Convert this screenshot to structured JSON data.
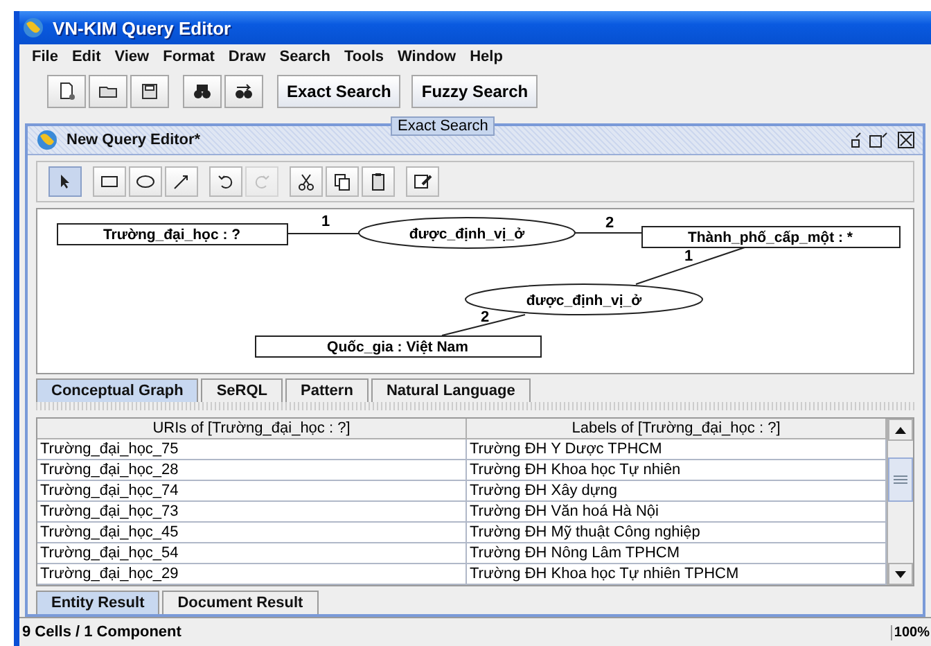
{
  "window": {
    "title": "VN-KIM Query Editor"
  },
  "menu": [
    {
      "label": "File"
    },
    {
      "label": "Edit"
    },
    {
      "label": "View"
    },
    {
      "label": "Format"
    },
    {
      "label": "Draw"
    },
    {
      "label": "Search"
    },
    {
      "label": "Tools"
    },
    {
      "label": "Window"
    },
    {
      "label": "Help"
    }
  ],
  "toolbar": {
    "icon_buttons": [
      {
        "kind": "new"
      },
      {
        "kind": "open"
      },
      {
        "kind": "save"
      },
      {
        "kind": "find"
      },
      {
        "kind": "replace"
      }
    ],
    "buttons": [
      "Exact Search",
      "Fuzzy Search"
    ]
  },
  "tooltip": "Exact Search",
  "internal_frame": {
    "title": "New Query Editor*"
  },
  "draw_tools": [
    {
      "kind": "pointer",
      "selected": true,
      "disabled": false
    },
    {
      "kind": "rect",
      "selected": false,
      "disabled": false
    },
    {
      "kind": "ellipse",
      "selected": false,
      "disabled": false
    },
    {
      "kind": "connector",
      "selected": false,
      "disabled": false
    },
    {
      "kind": "undo",
      "selected": false,
      "disabled": false
    },
    {
      "kind": "redo",
      "selected": false,
      "disabled": true
    },
    {
      "kind": "cut",
      "selected": false,
      "disabled": false
    },
    {
      "kind": "copy",
      "selected": false,
      "disabled": false
    },
    {
      "kind": "paste",
      "selected": false,
      "disabled": false
    },
    {
      "kind": "edit",
      "selected": false,
      "disabled": false
    }
  ],
  "graph": {
    "nodes": [
      {
        "kind": "concept",
        "label": "Trường_đại_học : ?"
      },
      {
        "kind": "relation",
        "label": "được_định_vị_ở"
      },
      {
        "kind": "concept",
        "label": "Thành_phố_cấp_một : *"
      },
      {
        "kind": "relation",
        "label": "được_định_vị_ở"
      },
      {
        "kind": "concept",
        "label": "Quốc_gia : Việt Nam"
      }
    ],
    "edges": [
      {
        "label": "1"
      },
      {
        "label": "2"
      },
      {
        "label": "1"
      },
      {
        "label": "2"
      }
    ]
  },
  "query_tabs": [
    {
      "label": "Conceptual Graph",
      "selected": true
    },
    {
      "label": "SeRQL",
      "selected": false
    },
    {
      "label": "Pattern",
      "selected": false
    },
    {
      "label": "Natural Language",
      "selected": false
    }
  ],
  "table": {
    "columns": [
      "URIs of [Trường_đại_học : ?]",
      "Labels of [Trường_đại_học : ?]"
    ],
    "rows": [
      [
        "Trường_đại_học_75",
        "Trường ĐH Y Dược TPHCM"
      ],
      [
        "Trường_đại_học_28",
        "Trường ĐH Khoa học Tự nhiên"
      ],
      [
        "Trường_đại_học_74",
        "Trường ĐH Xây dựng"
      ],
      [
        "Trường_đại_học_73",
        "Trường ĐH Văn hoá Hà Nội"
      ],
      [
        "Trường_đại_học_45",
        "Trường ĐH Mỹ thuật Công nghiệp"
      ],
      [
        "Trường_đại_học_54",
        "Trường ĐH Nông Lâm TPHCM"
      ],
      [
        "Trường_đại_học_29",
        "Trường ĐH Khoa học Tự nhiên TPHCM"
      ]
    ]
  },
  "result_tabs": [
    {
      "label": "Entity Result",
      "selected": true
    },
    {
      "label": "Document Result",
      "selected": false
    }
  ],
  "status_bar": {
    "text": "9 Cells / 1 Component",
    "zoom": "100%"
  }
}
